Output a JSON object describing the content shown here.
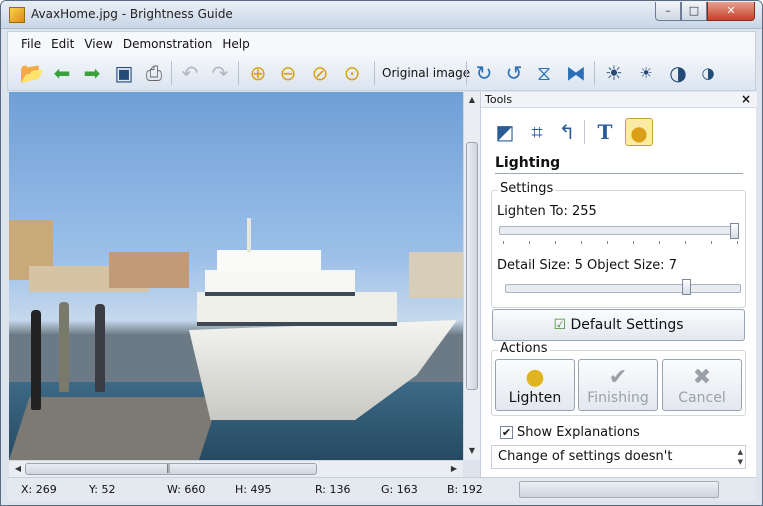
{
  "window": {
    "title": "AvaxHome.jpg - Brightness Guide"
  },
  "menu": [
    "File",
    "Edit",
    "View",
    "Demonstration",
    "Help"
  ],
  "toolbar": {
    "original_image_label": "Original image",
    "icons": [
      "open-icon",
      "back-arrow-icon",
      "forward-arrow-icon",
      "save-icon",
      "print-icon",
      "undo-icon",
      "redo-icon",
      "zoom-in-icon",
      "zoom-out-icon",
      "zoom-fit-icon",
      "zoom-actual-icon",
      "rotate-right-icon",
      "rotate-left-icon",
      "flip-vertical-icon",
      "flip-horizontal-icon",
      "brightness-up-icon",
      "brightness-down-icon",
      "contrast-up-icon",
      "contrast-down-icon"
    ]
  },
  "tools": {
    "title": "Tools",
    "close": "×",
    "section_title": "Lighting",
    "settings": {
      "label": "Settings",
      "lighten_to_label": "Lighten To: 255",
      "lighten_to_value": 255,
      "lighten_to_max": 255,
      "detail_object_label": "Detail Size: 5  Object Size: 7",
      "object_size_value": 7,
      "object_size_max": 9,
      "default_button": "Default Settings"
    },
    "actions": {
      "label": "Actions",
      "lighten": "Lighten",
      "finishing": "Finishing",
      "cancel": "Cancel"
    },
    "show_explanations": {
      "label": "Show Explanations",
      "checked": true
    },
    "explanation_text": "Change of settings doesn't"
  },
  "status": {
    "x": "X: 269",
    "y": "Y: 52",
    "w": "W: 660",
    "h": "H: 495",
    "r": "R: 136",
    "g": "G: 163",
    "b": "B: 192"
  }
}
